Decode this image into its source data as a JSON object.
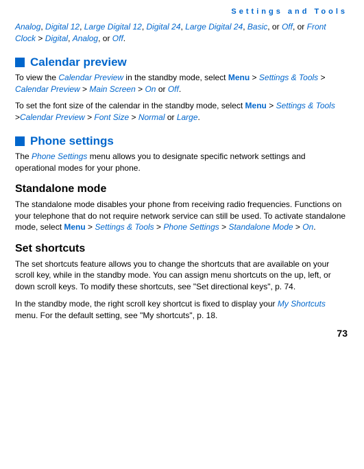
{
  "header": "Settings and Tools",
  "intro": {
    "t0": "Analog",
    "t1": ", ",
    "t2": "Digital 12",
    "t3": ", ",
    "t4": "Large Digital 12",
    "t5": ", ",
    "t6": "Digital 24",
    "t7": ", ",
    "t8": "Large Digital 24",
    "t9": ", ",
    "t10": "Basic",
    "t11": ", or ",
    "t12": "Off",
    "t13": ", or ",
    "t14": "Front Clock",
    "t15": " > ",
    "t16": "Digital",
    "t17": ", ",
    "t18": "Analog",
    "t19": ", or ",
    "t20": "Off",
    "t21": "."
  },
  "calendar": {
    "title": "Calendar preview",
    "p1": {
      "a": "To view the ",
      "b": "Calendar Preview",
      "c": "  in the standby mode, select ",
      "d": "Menu",
      "e": " > ",
      "f": "Settings & Tools",
      "g": " > ",
      "h": "Calendar Preview",
      "i": " > ",
      "j": "Main Screen",
      "k": " > ",
      "l": "On",
      "m": "  or ",
      "n": "Off",
      "o": "."
    },
    "p2": {
      "a": "To set the font size of the calendar in the standby mode, select ",
      "b": "Menu",
      "c": " > ",
      "d": "Settings & Tools",
      "e": " >",
      "f": "Calendar Preview",
      "g": " > ",
      "h": "Font Size",
      "i": " > ",
      "j": "Normal",
      "k": " or ",
      "l": "Large",
      "m": "."
    }
  },
  "phone": {
    "title": "Phone settings",
    "p1": {
      "a": "The ",
      "b": "Phone Settings",
      "c": " menu allows you to designate specific network settings and operational modes for your phone."
    }
  },
  "standalone": {
    "title": "Standalone mode",
    "p1": {
      "a": "The standalone mode disables your phone from receiving radio frequencies. Functions on your telephone that do not require network service can still be used. To activate standalone mode, select ",
      "b": "Menu",
      "c": " > ",
      "d": "Settings & Tools",
      "e": " > ",
      "f": "Phone Settings",
      "g": " > ",
      "h": "Standalone Mode",
      "i": " > ",
      "j": "On",
      "k": "."
    }
  },
  "shortcuts": {
    "title": "Set shortcuts",
    "p1": "The set shortcuts feature allows you to change the shortcuts that are available on your scroll key, while in the standby mode. You can assign menu shortcuts on the up, left, or down scroll keys. To modify these shortcuts, see \"Set directional keys\", p. 74.",
    "p2": {
      "a": "In the standby mode, the right scroll key shortcut is fixed to display your ",
      "b": "My Shortcuts",
      "c": " menu. For the default setting, see \"My shortcuts\", p. 18."
    }
  },
  "page_number": "73"
}
